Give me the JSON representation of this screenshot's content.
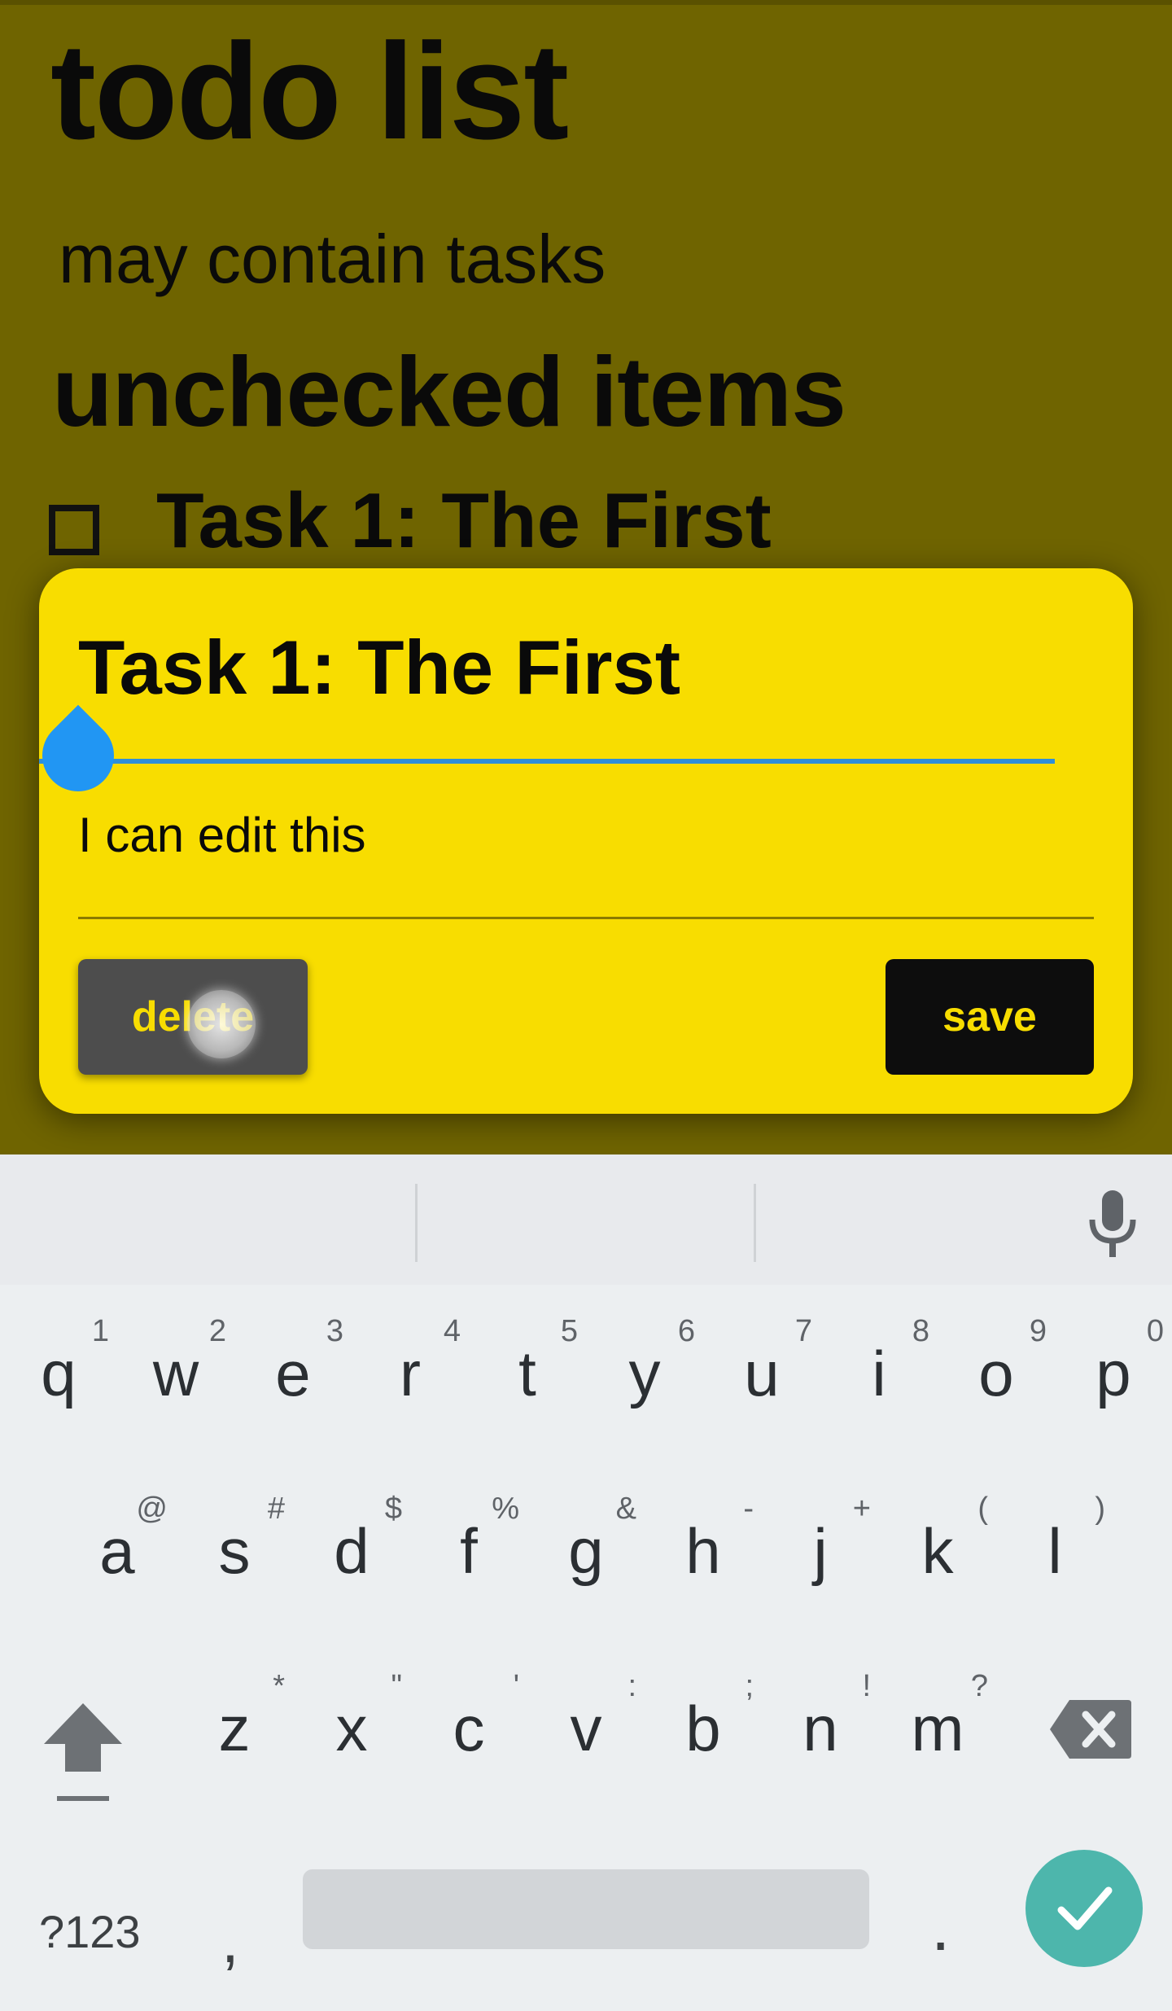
{
  "app": {
    "title": "todo list",
    "subtitle": "may contain tasks",
    "section_heading": "unchecked items",
    "tasks": [
      {
        "label": "Task 1: The First",
        "checked": false
      }
    ]
  },
  "dialog": {
    "title_value": "Task 1: The First",
    "description_value": "I can edit this",
    "delete_label": "delete",
    "save_label": "save"
  },
  "keyboard": {
    "row1": [
      {
        "key": "q",
        "hint": "1"
      },
      {
        "key": "w",
        "hint": "2"
      },
      {
        "key": "e",
        "hint": "3"
      },
      {
        "key": "r",
        "hint": "4"
      },
      {
        "key": "t",
        "hint": "5"
      },
      {
        "key": "y",
        "hint": "6"
      },
      {
        "key": "u",
        "hint": "7"
      },
      {
        "key": "i",
        "hint": "8"
      },
      {
        "key": "o",
        "hint": "9"
      },
      {
        "key": "p",
        "hint": "0"
      }
    ],
    "row2": [
      {
        "key": "a",
        "hint": "@"
      },
      {
        "key": "s",
        "hint": "#"
      },
      {
        "key": "d",
        "hint": "$"
      },
      {
        "key": "f",
        "hint": "%"
      },
      {
        "key": "g",
        "hint": "&"
      },
      {
        "key": "h",
        "hint": "-"
      },
      {
        "key": "j",
        "hint": "+"
      },
      {
        "key": "k",
        "hint": "("
      },
      {
        "key": "l",
        "hint": ")"
      }
    ],
    "row3": [
      {
        "key": "z",
        "hint": "*"
      },
      {
        "key": "x",
        "hint": "\""
      },
      {
        "key": "c",
        "hint": "'"
      },
      {
        "key": "v",
        "hint": ":"
      },
      {
        "key": "b",
        "hint": ";"
      },
      {
        "key": "n",
        "hint": "!"
      },
      {
        "key": "m",
        "hint": "?"
      }
    ],
    "symbols_label": "?123",
    "comma": ",",
    "period": "."
  },
  "colors": {
    "dialog_bg": "#f8dd00",
    "scrim_bg": "#6f6400",
    "accent_blue": "#2196f3",
    "enter_key": "#4db6ac"
  },
  "icons": [
    "mic-icon",
    "shift-icon",
    "backspace-icon",
    "check-icon"
  ]
}
